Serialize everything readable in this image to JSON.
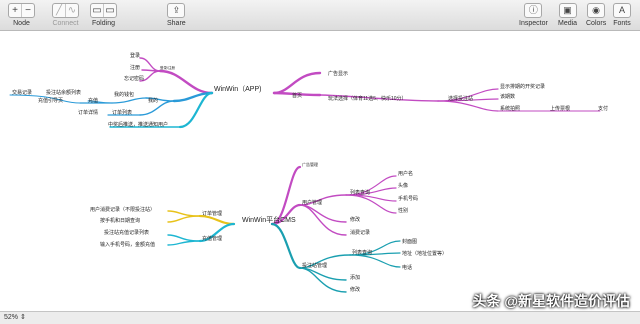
{
  "toolbar": {
    "node": {
      "label": "Node",
      "add": "+",
      "remove": "−"
    },
    "connect": {
      "label": "Connect"
    },
    "folding": {
      "label": "Folding"
    },
    "share": {
      "label": "Share",
      "icon": "share-icon"
    },
    "inspector": {
      "label": "Inspector",
      "icon": "info-icon"
    },
    "media": {
      "label": "Media",
      "icon": "image-icon"
    },
    "colors": {
      "label": "Colors",
      "icon": "palette-icon"
    },
    "fonts": {
      "label": "Fonts",
      "icon": "font-icon"
    }
  },
  "map": {
    "app": {
      "root": "WinWin（APP)",
      "login_group": "登录",
      "register": "注册",
      "forgot": "忘记密码",
      "tag_small": "登录/注册",
      "home": "首页",
      "ad": "广告显示",
      "play": "玩法选择（体育11选5、快乐10分）",
      "select_station": "选择投注站",
      "show_near": "显示排期的开奖记录",
      "match_period": "该期数",
      "system_calc": "系统拍照",
      "upload_ticket": "上传票根",
      "pay": "支付",
      "mine": "我的",
      "wallet": "我的钱包",
      "recharge": "充值",
      "recharge_page": "充值引导页",
      "trade_record": "交易记录",
      "trade_detail": "投注站余额列表",
      "order_list": "订单列表",
      "order_detail": "订单详情",
      "win_msg": "中奖后推送，推送通知用户"
    },
    "cms": {
      "root": "WinWin平台CMS",
      "ad_mgmt": "广告管理",
      "user_mgmt": "用户管理",
      "user_list": "列表查询",
      "username": "用户名",
      "avatar": "头像",
      "phone": "手机号码",
      "gender": "性别",
      "edit": "修改",
      "consume": "消费记录",
      "order_mgmt": "订单管理",
      "user_consume": "用户消费记录（不限投注站）",
      "by_phone": "按手机和日期查询",
      "recharge_mgmt": "充值管理",
      "station_recharge": "投注站充值记录列表",
      "input_phone": "输入手机号码，金额充值",
      "station_mgmt": "投注站管理",
      "station_list": "列表查询",
      "store_name": "封面图",
      "address": "地址（地址位置等）",
      "tel": "电话",
      "add": "添加",
      "modify": "修改"
    }
  },
  "status": {
    "zoom": "52%",
    "zoom_icon": "stepper-icon"
  },
  "watermark": "头条 @新星软件造价评估",
  "colors": {
    "magenta": "#c24bc2",
    "blue": "#2a9ad8",
    "cyan": "#1db6d2",
    "yellow": "#e8c21a",
    "teal": "#1a9fb0"
  }
}
